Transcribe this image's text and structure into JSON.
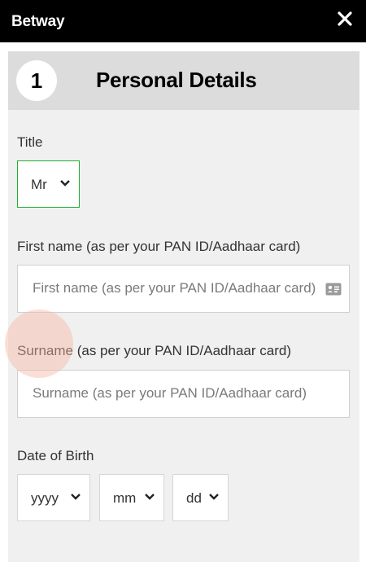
{
  "app": {
    "brand": "Betway"
  },
  "step": {
    "number": "1",
    "title": "Personal Details"
  },
  "form": {
    "title_label": "Title",
    "title_value": "Mr",
    "first_name_label": "First name (as per your PAN ID/Aadhaar card)",
    "first_name_placeholder": "First name (as per your PAN ID/Aadhaar card)",
    "surname_label": "Surname (as per your PAN ID/Aadhaar card)",
    "surname_placeholder": "Surname (as per your PAN ID/Aadhaar card)",
    "dob_label": "Date of Birth",
    "dob_year": "yyyy",
    "dob_month": "mm",
    "dob_day": "dd"
  },
  "icons": {
    "close": "close-icon",
    "chevron": "chevron-down-icon",
    "id_card": "id-card-icon"
  },
  "colors": {
    "topbar": "#000000",
    "active_border": "#1fb02b",
    "panel": "#f0f0f0",
    "header": "#dcdcdc"
  }
}
